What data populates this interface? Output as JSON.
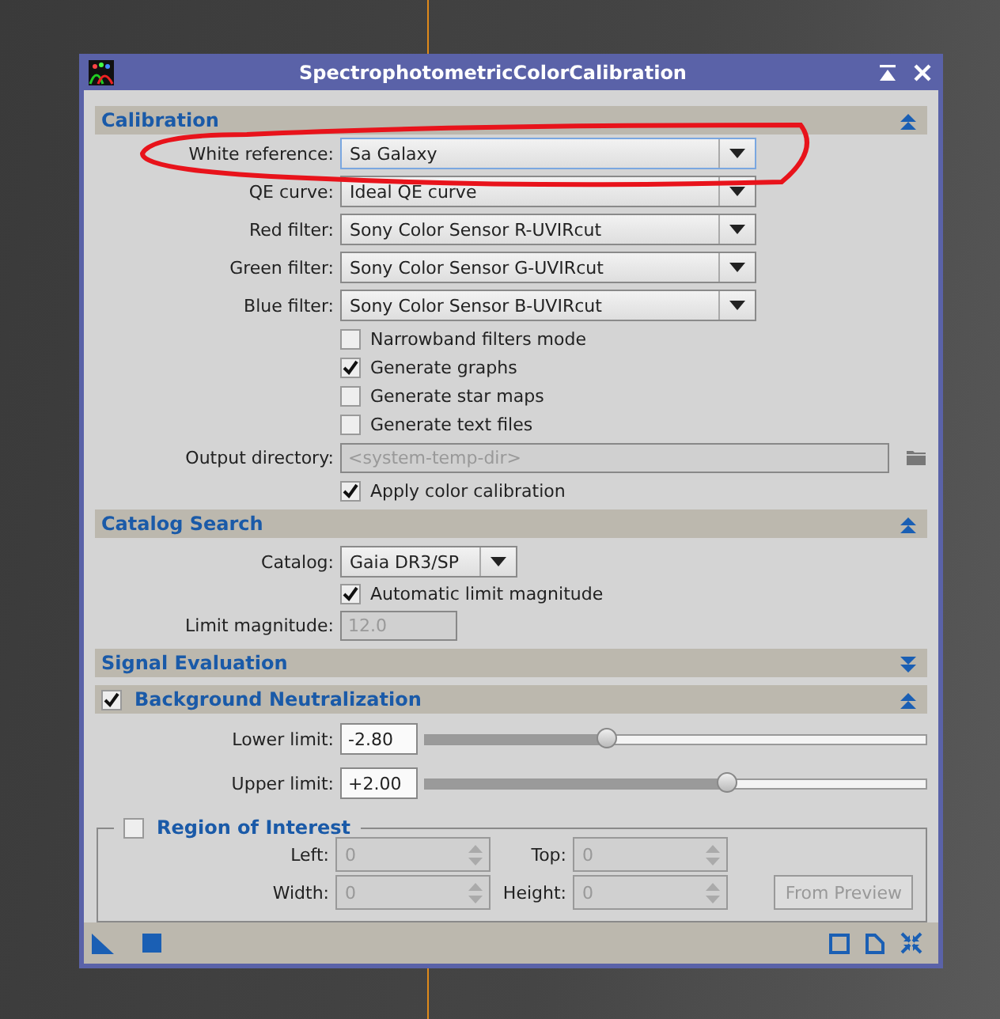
{
  "window": {
    "title": "SpectrophotometricColorCalibration"
  },
  "calibration": {
    "title": "Calibration",
    "expanded": true,
    "combos": [
      {
        "label": "White reference:",
        "value": "Sa Galaxy",
        "focused": true
      },
      {
        "label": "QE curve:",
        "value": "Ideal QE curve",
        "focused": false
      },
      {
        "label": "Red filter:",
        "value": "Sony Color Sensor R-UVIRcut",
        "focused": false
      },
      {
        "label": "Green filter:",
        "value": "Sony Color Sensor G-UVIRcut",
        "focused": false
      },
      {
        "label": "Blue filter:",
        "value": "Sony Color Sensor B-UVIRcut",
        "focused": false
      }
    ],
    "checks": [
      {
        "label": "Narrowband filters mode",
        "checked": false
      },
      {
        "label": "Generate graphs",
        "checked": true
      },
      {
        "label": "Generate star maps",
        "checked": false
      },
      {
        "label": "Generate text files",
        "checked": false
      }
    ],
    "output_directory": {
      "label": "Output directory:",
      "placeholder": "<system-temp-dir>",
      "disabled": true
    },
    "apply": {
      "label": "Apply color calibration",
      "checked": true
    }
  },
  "catalog_search": {
    "title": "Catalog Search",
    "expanded": true,
    "catalog": {
      "label": "Catalog:",
      "value": "Gaia DR3/SP"
    },
    "auto_limit": {
      "label": "Automatic limit magnitude",
      "checked": true
    },
    "limit_magnitude": {
      "label": "Limit magnitude:",
      "value": "12.0",
      "disabled": true
    }
  },
  "signal_evaluation": {
    "title": "Signal Evaluation",
    "expanded": false
  },
  "background_neutralization": {
    "title": "Background Neutralization",
    "checked": true,
    "expanded": true,
    "limits": [
      {
        "label": "Lower limit:",
        "value": "-2.80",
        "level": 0.36
      },
      {
        "label": "Upper limit:",
        "value": "+2.00",
        "level": 0.6
      }
    ],
    "roi": {
      "title": "Region of Interest",
      "checked": false,
      "fields": [
        {
          "label": "Left:",
          "value": "0"
        },
        {
          "label": "Top:",
          "value": "0"
        },
        {
          "label": "Width:",
          "value": "0"
        },
        {
          "label": "Height:",
          "value": "0"
        }
      ],
      "button": "From Preview"
    }
  }
}
